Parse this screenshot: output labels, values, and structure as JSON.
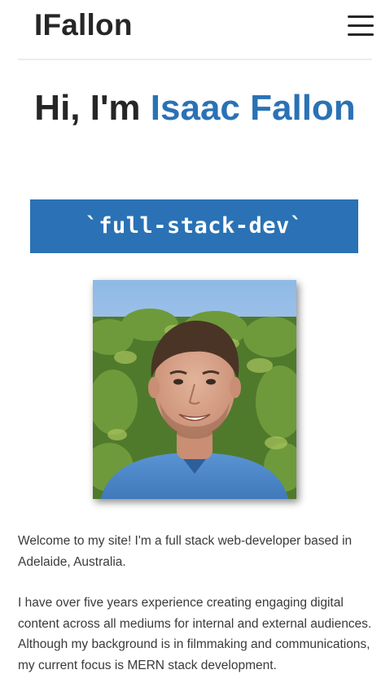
{
  "nav": {
    "brand": "IFallon",
    "menu_icon": "hamburger-menu-icon"
  },
  "hero": {
    "greeting": "Hi, I'm",
    "name": "Isaac Fallon",
    "role": "`full-stack-dev`",
    "accent_color": "#2a72b5"
  },
  "portrait": {
    "alt": "Portrait photo"
  },
  "bio": {
    "paragraphs": [
      "Welcome to my site! I'm a full stack web-developer based in Adelaide, Australia.",
      "I have over five years experience creating engaging digital content across all mediums for internal and external audiences. Although my background is in filmmaking and communications, my current focus is MERN stack development."
    ]
  }
}
